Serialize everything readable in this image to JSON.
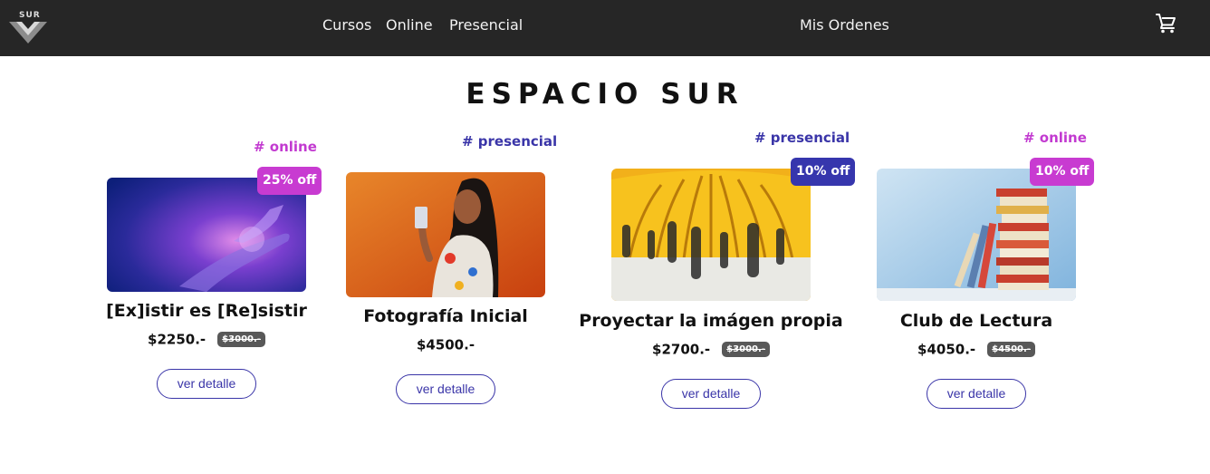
{
  "nav": {
    "logo_text": "SUR",
    "links": [
      "Cursos",
      "Online",
      "Presencial"
    ],
    "orders_label": "Mis Ordenes",
    "cart_icon": "cart-icon"
  },
  "page": {
    "title": "ESPACIO SUR"
  },
  "colors": {
    "navbar_bg": "#262626",
    "tag_online": "#c23ad0",
    "tag_presencial": "#3a35a8",
    "discount_magenta": "#c83bd1",
    "discount_blue": "#3636ad",
    "button_border": "#3a35a8"
  },
  "products": [
    {
      "tag": "# online",
      "discount": "25% off",
      "name": "[Ex]istir es [Re]sistir",
      "price": "$2250.-",
      "old_price": "$3000.-",
      "button": "ver detalle"
    },
    {
      "tag": "# presencial",
      "name": "Fotografía Inicial",
      "price": "$4500.-",
      "button": "ver detalle"
    },
    {
      "tag": "# presencial",
      "discount": "10% off",
      "name": "Proyectar la imágen propia",
      "price": "$2700.-",
      "old_price": "$3000.-",
      "button": "ver detalle"
    },
    {
      "tag": "# online",
      "discount": "10% off",
      "name": "Club de Lectura",
      "price": "$4050.-",
      "old_price": "$4500.-",
      "button": "ver detalle"
    }
  ]
}
